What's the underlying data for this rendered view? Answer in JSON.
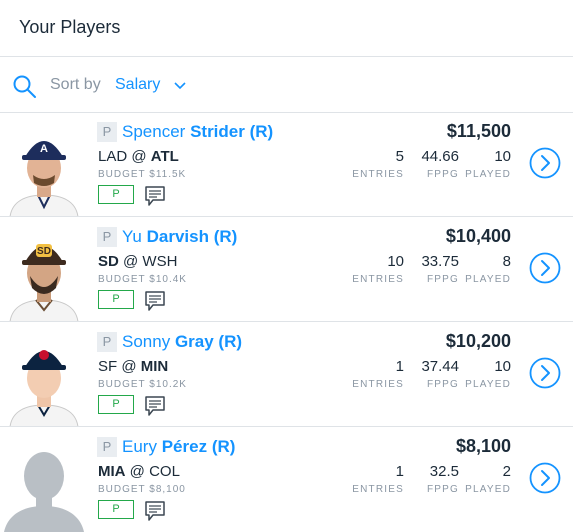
{
  "header": {
    "title": "Your Players"
  },
  "sort": {
    "label": "Sort by",
    "value": "Salary"
  },
  "stat_labels": {
    "entries": "ENTRIES",
    "fppg": "FPPG",
    "played": "PLAYED"
  },
  "players": [
    {
      "position": "P",
      "first": "Spencer",
      "last": "Strider",
      "hand": "(R)",
      "away": "LAD",
      "at": "@",
      "home": "ATL",
      "bold_team": "home",
      "budget": "BUDGET $11.5K",
      "badge": "P",
      "salary": "$11,500",
      "entries": "5",
      "fppg": "44.66",
      "played": "10",
      "avatar": "braves"
    },
    {
      "position": "P",
      "first": "Yu",
      "last": "Darvish",
      "hand": "(R)",
      "away": "SD",
      "at": "@",
      "home": "WSH",
      "bold_team": "away",
      "budget": "BUDGET $10.4K",
      "badge": "P",
      "salary": "$10,400",
      "entries": "10",
      "fppg": "33.75",
      "played": "8",
      "avatar": "padres"
    },
    {
      "position": "P",
      "first": "Sonny",
      "last": "Gray",
      "hand": "(R)",
      "away": "SF",
      "at": "@",
      "home": "MIN",
      "bold_team": "home",
      "budget": "BUDGET $10.2K",
      "badge": "P",
      "salary": "$10,200",
      "entries": "1",
      "fppg": "37.44",
      "played": "10",
      "avatar": "twins"
    },
    {
      "position": "P",
      "first": "Eury",
      "last": "Pérez",
      "hand": "(R)",
      "away": "MIA",
      "at": "@",
      "home": "COL",
      "bold_team": "away",
      "budget": "BUDGET $8,100",
      "badge": "P",
      "salary": "$8,100",
      "entries": "1",
      "fppg": "32.5",
      "played": "2",
      "avatar": "placeholder"
    }
  ],
  "colors": {
    "accent": "#1493ff",
    "text": "#1c2b39",
    "muted": "#8a96a3",
    "badge": "#23a84a",
    "divider": "#dfe3e7"
  }
}
